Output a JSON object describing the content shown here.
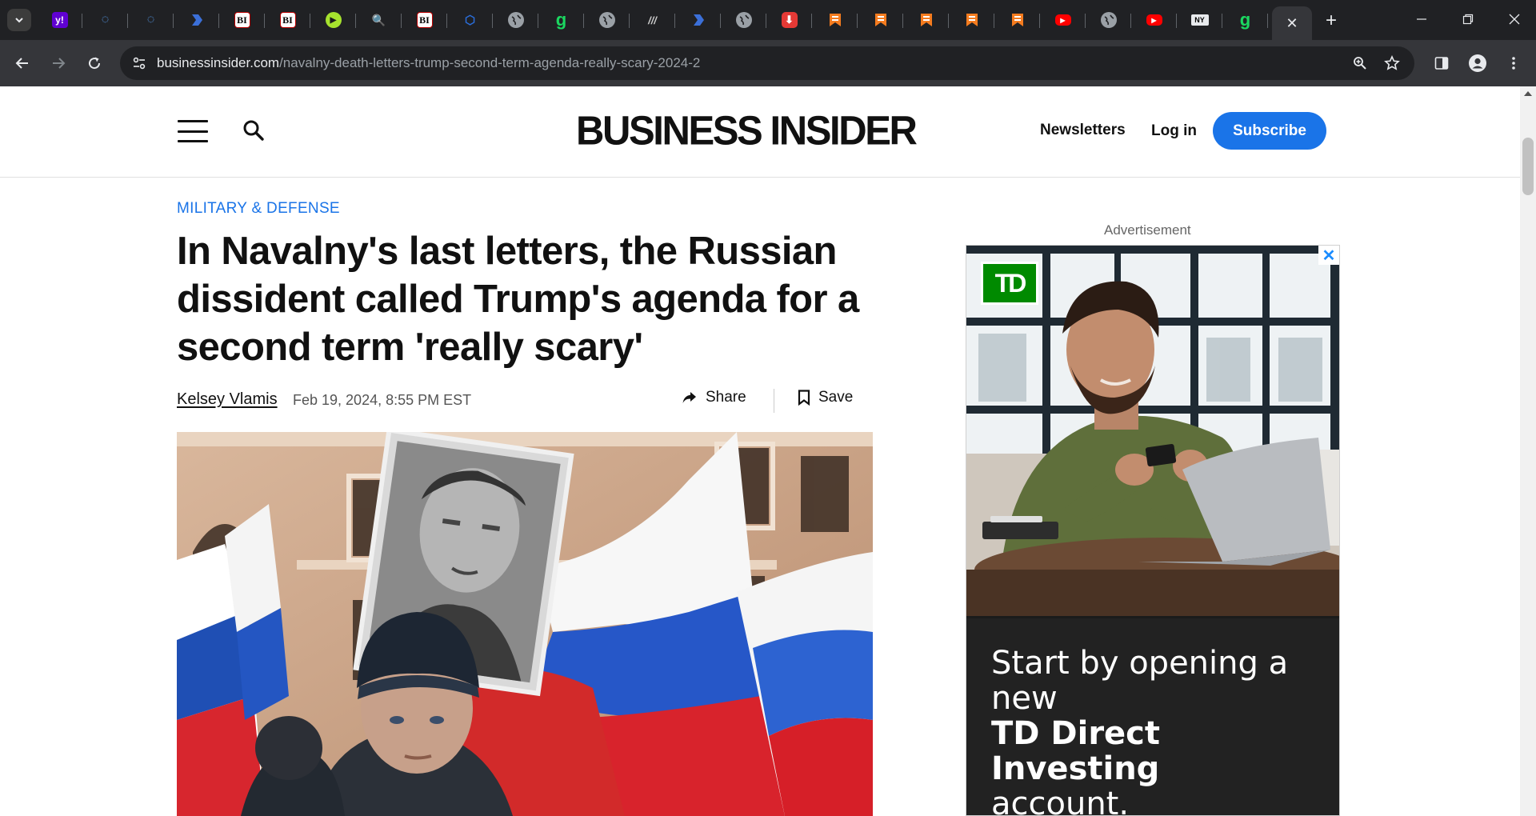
{
  "browser": {
    "tabs_pinned": [
      {
        "icon": "yahoo-icon",
        "glyph": "y!"
      },
      {
        "icon": "shield-icon",
        "glyph": "◌"
      },
      {
        "icon": "shield-icon",
        "glyph": "◌"
      },
      {
        "icon": "arrow-icon",
        "glyph": ""
      },
      {
        "icon": "business-insider-icon",
        "glyph": "BI"
      },
      {
        "icon": "business-insider-icon",
        "glyph": "BI"
      },
      {
        "icon": "play-icon",
        "glyph": "▶"
      },
      {
        "icon": "search-icon",
        "glyph": "🔍"
      },
      {
        "icon": "business-insider-icon",
        "glyph": "BI"
      },
      {
        "icon": "cube-icon",
        "glyph": "⬡"
      },
      {
        "icon": "globe-icon",
        "glyph": ""
      },
      {
        "icon": "g-icon",
        "glyph": "g"
      },
      {
        "icon": "globe-icon",
        "glyph": ""
      },
      {
        "icon": "slash-icon",
        "glyph": "///"
      },
      {
        "icon": "arrow-icon",
        "glyph": ""
      },
      {
        "icon": "globe-icon",
        "glyph": ""
      },
      {
        "icon": "pin-icon",
        "glyph": "⬇"
      },
      {
        "icon": "bookmark-icon",
        "glyph": ""
      },
      {
        "icon": "bookmark-icon",
        "glyph": ""
      },
      {
        "icon": "bookmark-icon",
        "glyph": ""
      },
      {
        "icon": "bookmark-icon",
        "glyph": ""
      },
      {
        "icon": "bookmark-icon",
        "glyph": ""
      },
      {
        "icon": "youtube-icon",
        "glyph": "▶"
      },
      {
        "icon": "globe-icon",
        "glyph": ""
      },
      {
        "icon": "youtube-icon",
        "glyph": "▶"
      },
      {
        "icon": "news-icon",
        "glyph": "NY"
      },
      {
        "icon": "g-icon",
        "glyph": "g"
      }
    ],
    "active_tab_close": "✕",
    "new_tab": "+",
    "window_controls": {
      "minimize": "—",
      "restore": "❐",
      "close": "✕"
    },
    "url_domain": "businessinsider.com",
    "url_path": "/navalny-death-letters-trump-second-term-agenda-really-scary-2024-2"
  },
  "header": {
    "logo": "BUSINESS INSIDER",
    "newsletters": "Newsletters",
    "login": "Log in",
    "subscribe": "Subscribe"
  },
  "article": {
    "category": "MILITARY & DEFENSE",
    "headline": "In Navalny's last letters, the Russian dissident called Trump's agenda for a second term 'really scary'",
    "author": "Kelsey Vlamis",
    "date": "Feb 19, 2024, 8:55 PM EST",
    "share_label": "Share",
    "save_label": "Save"
  },
  "ad": {
    "label": "Advertisement",
    "logo": "TD",
    "close": "✕",
    "copy_line1": "Start by opening a new",
    "copy_bold": "TD Direct Investing",
    "copy_line3": "account."
  },
  "colors": {
    "chrome_dark": "#202124",
    "toolbar": "#35363a",
    "accent_blue": "#1a74e8",
    "td_green": "#008a00"
  }
}
